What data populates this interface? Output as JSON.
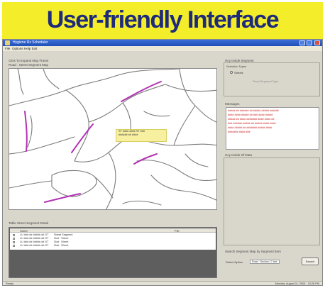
{
  "banner": {
    "title": "User-friendly Interface"
  },
  "window": {
    "title": "Hygiene Rx Scheduler"
  },
  "menubar": {
    "items": [
      "File",
      "Options",
      "Help",
      "Exit"
    ]
  },
  "map_panel": {
    "title": "Click To Expand Map Frame",
    "subtitle": "Road · Street Segment Map"
  },
  "map": {
    "tooltip": [
      "ST #### #### ST ###",
      "###### ## ####"
    ]
  },
  "table_panel": {
    "title": "Table Street Segment Detail",
    "columns": [
      "Street",
      "PID"
    ],
    "rows": [
      {
        "street": "LU ### ## ##### ## ST",
        "detail": "Street Segment"
      },
      {
        "street": "LU ### ## ##### ## ST",
        "detail": "Stat · Street"
      },
      {
        "street": "LU ### ## ##### ## ST",
        "detail": "Stat · Street"
      },
      {
        "street": "LU ### ## ##### ## ST",
        "detail": "Stat · Street"
      }
    ]
  },
  "right_panel": {
    "group_title": "Hoy Inside Segment",
    "subgroup_title": "Selection Types",
    "option_1": "Streets",
    "option_2": "Road Segment Type",
    "message_title": "Messages",
    "messages": [
      "##### ## ###### ## ##### ##### ######",
      "#### #### ##### ## ### #### #####",
      "##### ## #### ####### #### #### ##",
      "### ###### ##### ## ##### #### ####",
      "#### ##### ## ####### ##### ####",
      "####### #### ###"
    ],
    "selected_title": "Hoy Inside Of Data",
    "search_title": "Search Segment Map by Segment Item",
    "search_label": "Select Option",
    "search_value": "Road · Section 17 text",
    "search_button": "Search"
  },
  "statusbar": {
    "left": "Ready",
    "right": "Monday, August 11, 2003 · 10:28 PM"
  },
  "colors": {
    "banner_bg": "#f4ee2a",
    "banner_text": "#1e2a7a",
    "highlight_road": "#b431b4",
    "message_text": "#cc1b1b",
    "tooltip_bg": "#f6f0a0"
  },
  "icons": [
    "app-icon",
    "minimize-icon",
    "maximize-icon",
    "close-icon"
  ]
}
